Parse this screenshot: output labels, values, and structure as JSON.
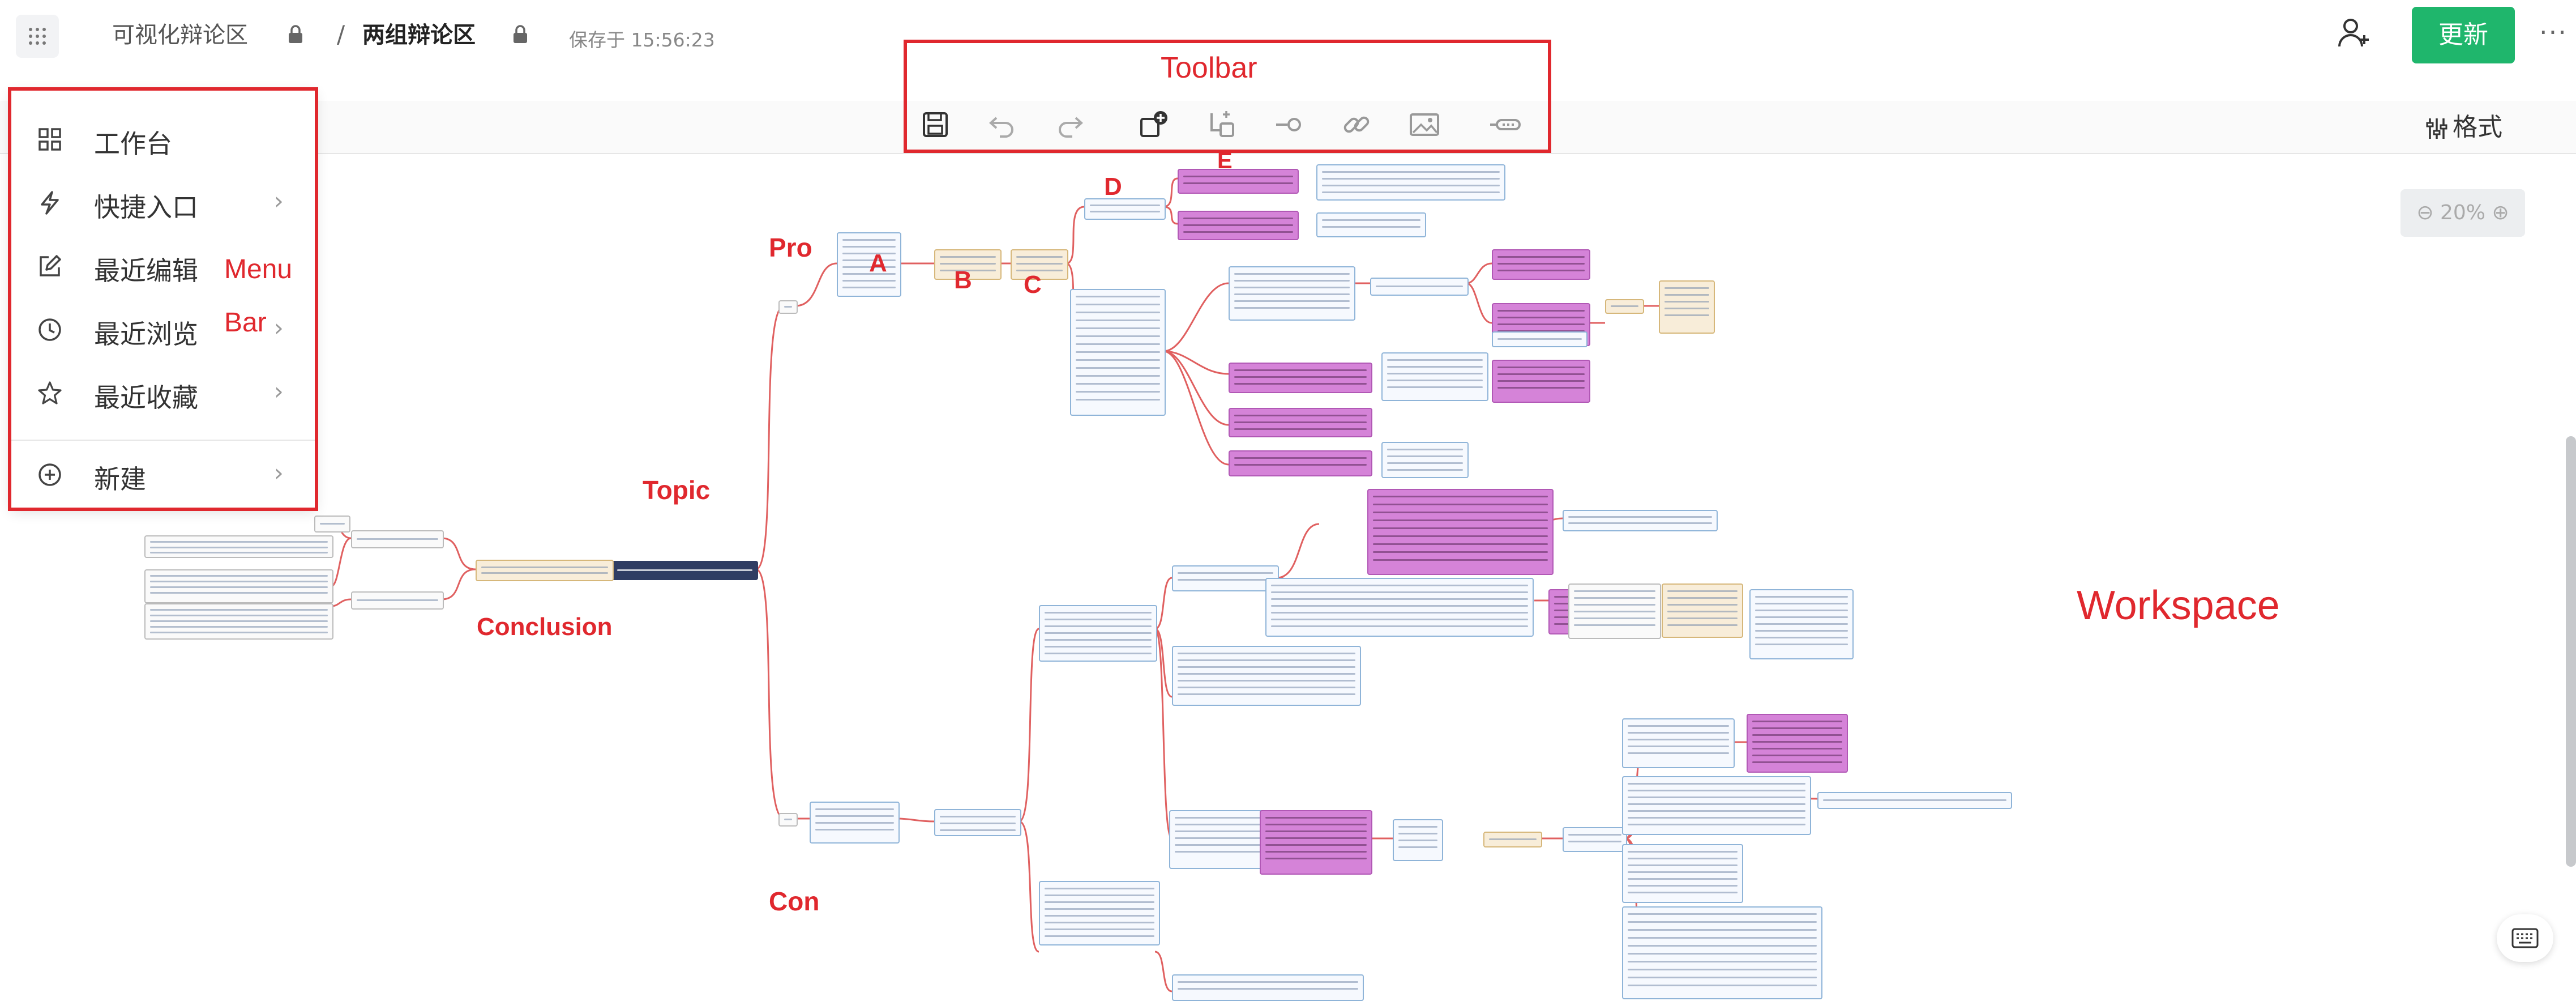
{
  "header": {
    "root_title": "可视化辩论区",
    "separator": "/",
    "doc_title": "两组辩论区",
    "saved_status": "保存于 15:56:23",
    "update_label": "更新",
    "more_label": "···"
  },
  "toolbar": {
    "icons": [
      "save-icon",
      "undo-icon",
      "redo-icon",
      "add-child-node-icon",
      "add-sibling-node-icon",
      "add-connector-icon",
      "link-icon",
      "image-icon",
      "collapse-icon"
    ],
    "format_label": "格式"
  },
  "menu": {
    "items": [
      {
        "label": "工作台",
        "icon": "grid-icon",
        "has_arrow": false
      },
      {
        "label": "快捷入口",
        "icon": "lightning-icon",
        "has_arrow": true
      },
      {
        "label": "最近编辑",
        "icon": "edit-icon",
        "has_arrow": false
      },
      {
        "label": "最近浏览",
        "icon": "clock-icon",
        "has_arrow": true
      },
      {
        "label": "最近收藏",
        "icon": "star-icon",
        "has_arrow": true
      },
      {
        "label": "新建",
        "icon": "plus-circle-icon",
        "has_arrow": true
      }
    ],
    "arrow": "›"
  },
  "workspace": {
    "zoom_label": "20%",
    "colors": {
      "node_pink": "#d583d8",
      "node_border": "#8fb4d8",
      "topic": "#2f3d63",
      "link_red": "#e06060",
      "annotation": "#e0282e",
      "update_green": "#1fb66c"
    }
  },
  "annotations": {
    "toolbar": "Toolbar",
    "menu_line1": "Menu",
    "menu_line2": "Bar",
    "topic": "Topic",
    "conclusion": "Conclusion",
    "pro": "Pro",
    "con": "Con",
    "workspace": "Workspace",
    "a": "A",
    "b": "B",
    "c": "C",
    "d": "D",
    "e": "E"
  }
}
